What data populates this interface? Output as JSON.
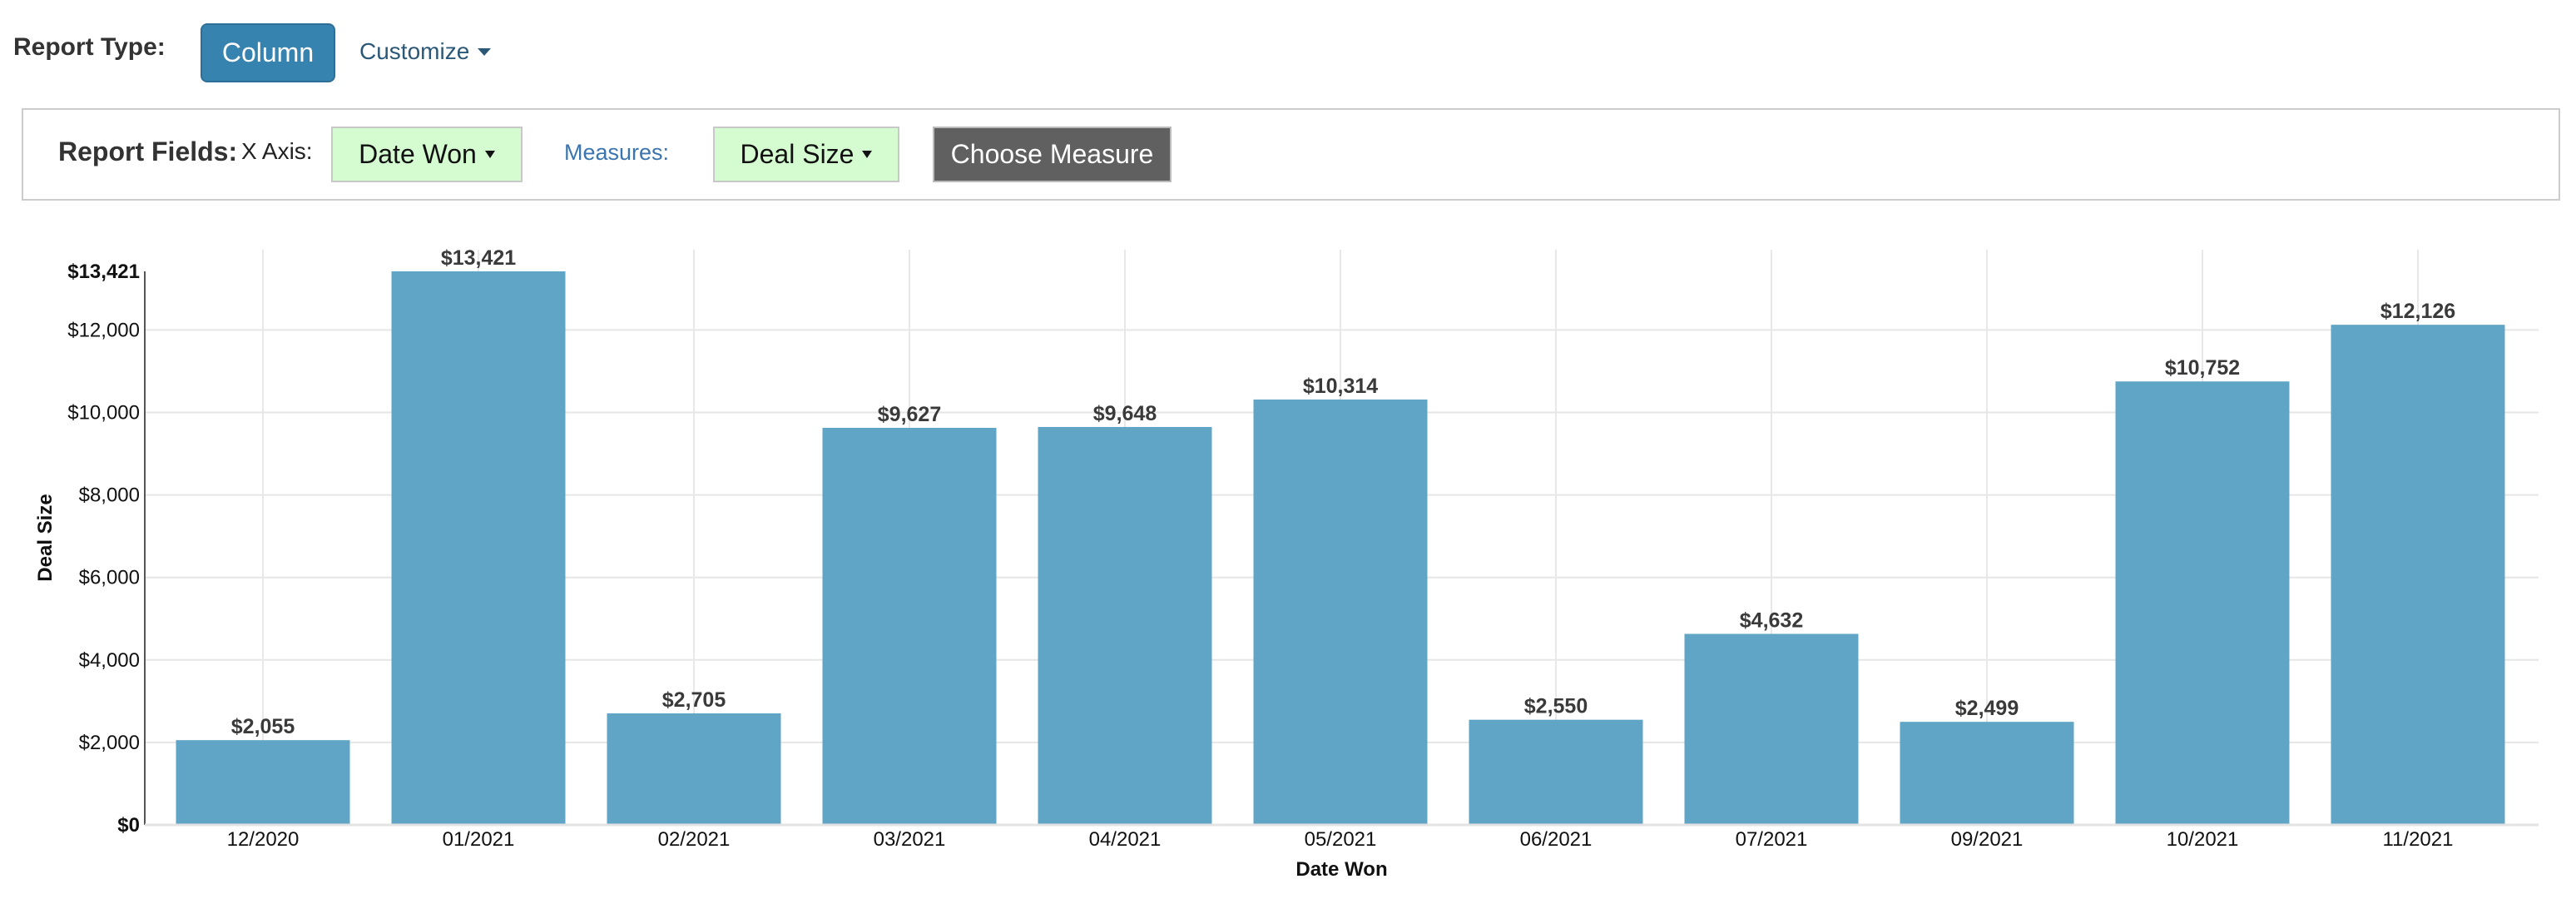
{
  "header": {
    "report_type_label": "Report Type:",
    "report_type_button": "Column",
    "customize_label": "Customize"
  },
  "fields": {
    "report_fields_label": "Report Fields:",
    "x_axis_label": "X Axis:",
    "x_axis_value": "Date Won",
    "measures_label": "Measures:",
    "measure_value": "Deal Size",
    "choose_measure_button": "Choose Measure"
  },
  "colors": {
    "primary_button": "#3783b0",
    "field_button_bg": "#d5fbd0",
    "choose_button_bg": "#606060",
    "bar_fill": "#5ba1c4",
    "measures_link": "#3a75b0"
  },
  "chart_data": {
    "type": "bar",
    "title": "",
    "xlabel": "Date Won",
    "ylabel": "Deal Size",
    "categories": [
      "12/2020",
      "01/2021",
      "02/2021",
      "03/2021",
      "04/2021",
      "05/2021",
      "06/2021",
      "07/2021",
      "09/2021",
      "10/2021",
      "11/2021"
    ],
    "values": [
      2055,
      13421,
      2705,
      9627,
      9648,
      10314,
      2550,
      4632,
      2499,
      10752,
      12126
    ],
    "value_labels": [
      "$2,055",
      "$13,421",
      "$2,705",
      "$9,627",
      "$9,648",
      "$10,314",
      "$2,550",
      "$4,632",
      "$2,499",
      "$10,752",
      "$12,126"
    ],
    "ylim": [
      0,
      13421
    ],
    "yticks": [
      0,
      2000,
      4000,
      6000,
      8000,
      10000,
      12000,
      13421
    ],
    "ytick_labels": [
      "$0",
      "$2,000",
      "$4,000",
      "$6,000",
      "$8,000",
      "$10,000",
      "$12,000",
      "$13,421"
    ],
    "grid": true,
    "legend": "none"
  }
}
